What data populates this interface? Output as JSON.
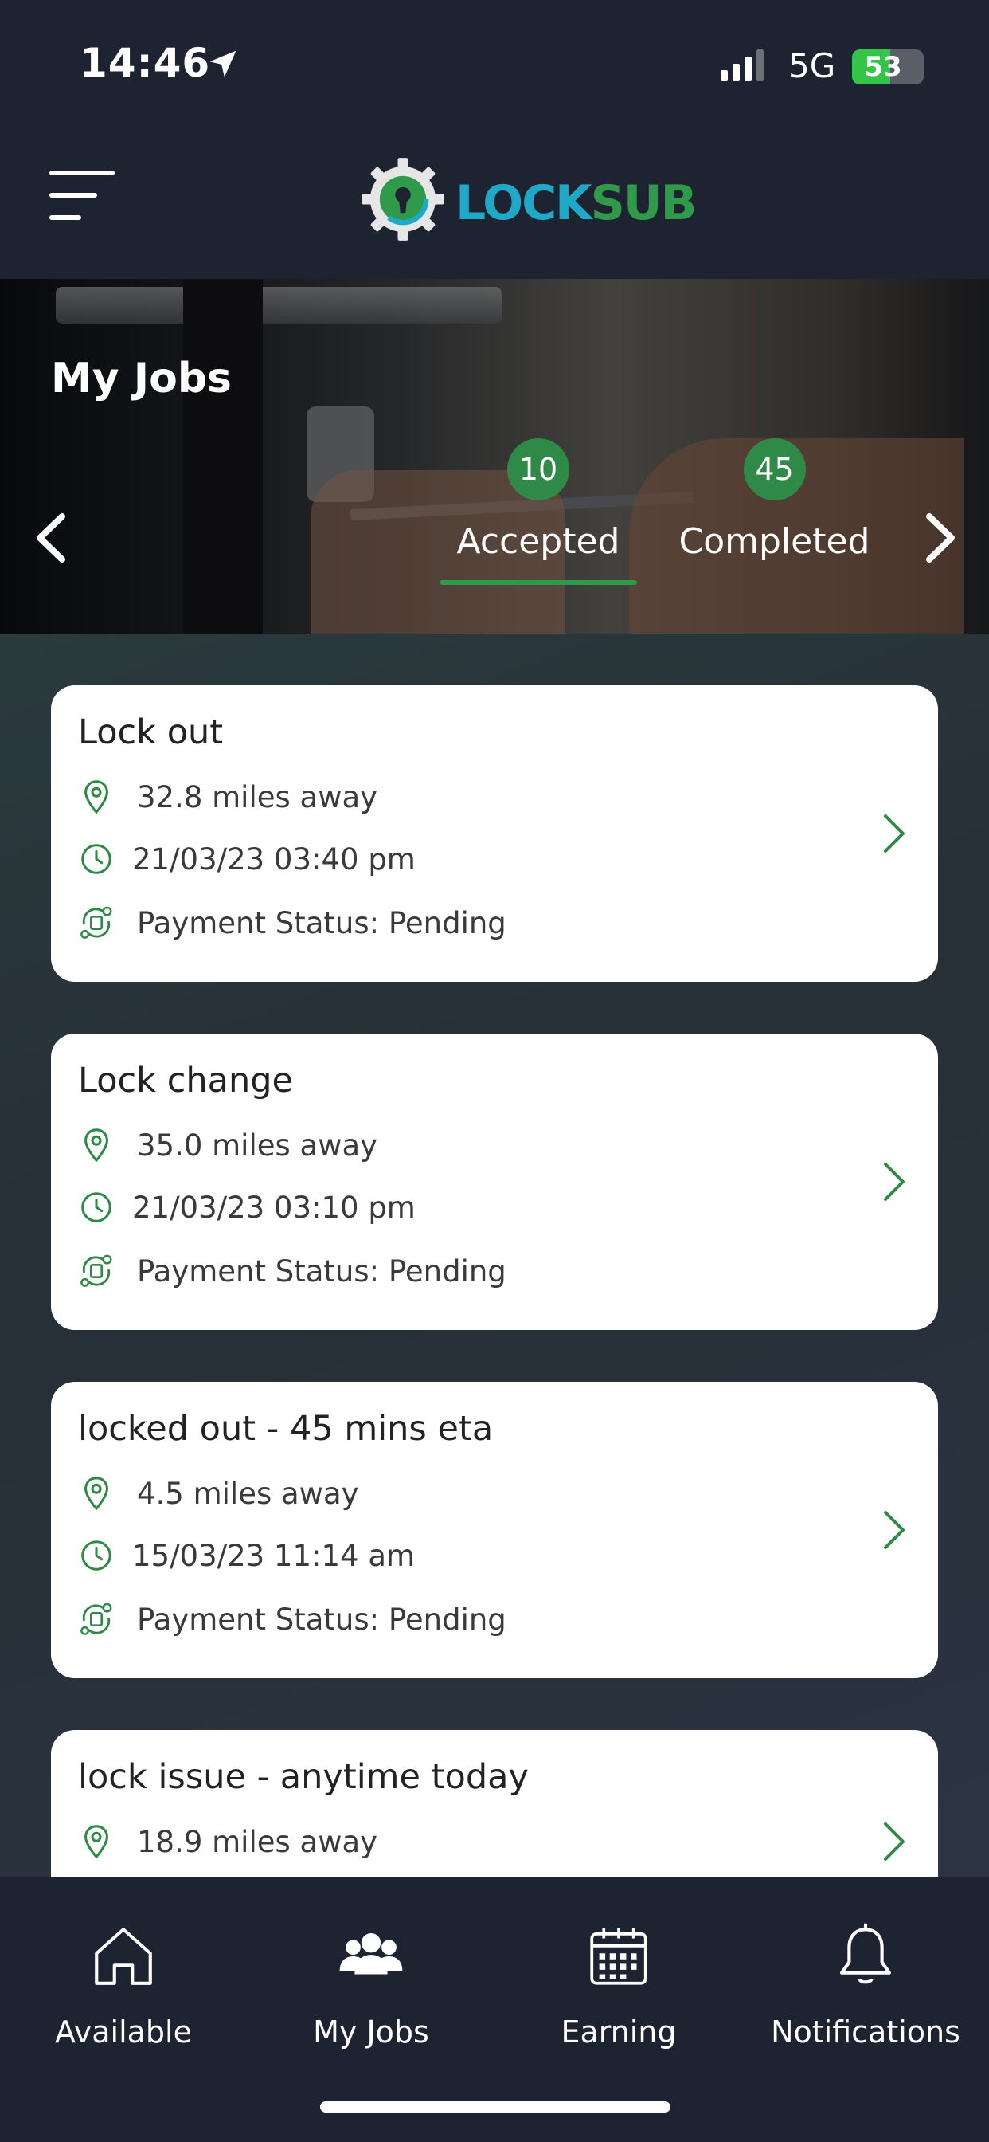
{
  "status_bar": {
    "time": "14:46",
    "network": "5G",
    "battery": "53",
    "battery_level": 0.53,
    "location_icon": "location-arrow-icon",
    "signal_icon": "signal-bars-icon"
  },
  "header": {
    "menu_icon": "hamburger-menu-icon",
    "logo": {
      "part1": "LOCK",
      "part2": "SUB",
      "icon": "gear-keyhole-logo-icon"
    }
  },
  "banner": {
    "title": "My Jobs",
    "prev_icon": "chevron-left-icon",
    "next_icon": "chevron-right-icon",
    "tabs": [
      {
        "label": "Accepted",
        "count": "10",
        "active": true
      },
      {
        "label": "Completed",
        "count": "45",
        "active": false
      }
    ]
  },
  "jobs": [
    {
      "title": "Lock out",
      "distance": "32.8 miles away",
      "datetime": "21/03/23 03:40 pm",
      "payment": "Payment Status: Pending"
    },
    {
      "title": "Lock change",
      "distance": "35.0 miles away",
      "datetime": "21/03/23 03:10 pm",
      "payment": "Payment Status: Pending"
    },
    {
      "title": "locked out - 45 mins eta",
      "distance": "4.5 miles away",
      "datetime": "15/03/23 11:14 am",
      "payment": "Payment Status: Pending"
    },
    {
      "title": "lock issue - anytime today",
      "distance": "18.9 miles away"
    }
  ],
  "nav": {
    "items": [
      {
        "label": "Available",
        "icon": "home-icon"
      },
      {
        "label": "My Jobs",
        "icon": "group-people-icon"
      },
      {
        "label": "Earning",
        "icon": "calendar-icon"
      },
      {
        "label": "Notifications",
        "icon": "bell-icon"
      }
    ]
  },
  "colors": {
    "brand_green": "#2f9a4a",
    "brand_blue": "#1fa9c9",
    "dark_bg": "#1e2331",
    "card_bg": "#ffffff"
  }
}
